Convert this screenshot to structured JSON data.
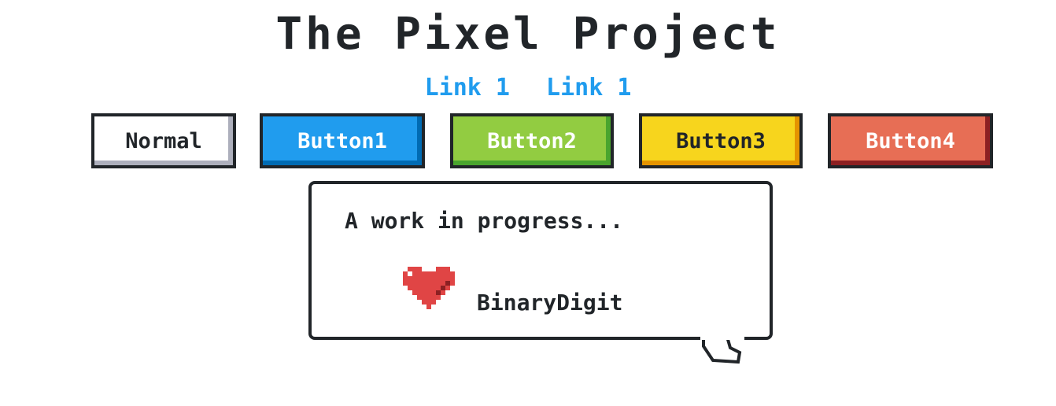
{
  "page": {
    "title": "The Pixel Project"
  },
  "links": [
    {
      "label": "Link 1"
    },
    {
      "label": "Link 1"
    }
  ],
  "buttons": [
    {
      "label": "Normal",
      "color": "#ffffff"
    },
    {
      "label": "Button1",
      "color": "#209cee"
    },
    {
      "label": "Button2",
      "color": "#92cc41"
    },
    {
      "label": "Button3",
      "color": "#f7d51d"
    },
    {
      "label": "Button4",
      "color": "#e76e55"
    }
  ],
  "balloon": {
    "message": "A work in progress...",
    "icon": "heart-icon",
    "icon_color": "#e76e55",
    "author": "BinaryDigit"
  }
}
